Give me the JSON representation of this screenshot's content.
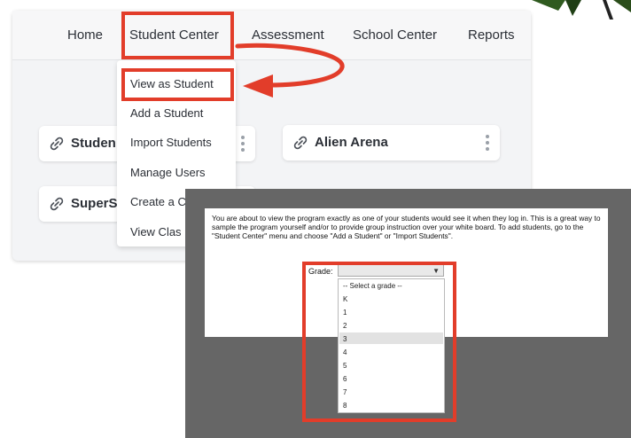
{
  "nav": {
    "home": "Home",
    "student_center": "Student Center",
    "assessment": "Assessment",
    "school_center": "School Center",
    "reports": "Reports"
  },
  "cards": [
    {
      "label": "Studen",
      "icon": "link-icon"
    },
    {
      "label": "Alien Arena",
      "icon": "link-icon"
    },
    {
      "label": "SuperS",
      "icon": "link-icon"
    }
  ],
  "menu": {
    "items": [
      "View as Student",
      "Add a Student",
      "Import Students",
      "Manage Users",
      "Create a C",
      "View Clas"
    ]
  },
  "modal": {
    "message": "You are about to view the program exactly as one of your students would see it when they log in. This is a great way to sample the program yourself and/or to provide group instruction over your white board. To add students, go to the \"Student Center\" menu and choose \"Add a Student\" or \"Import Students\".",
    "grade_label": "Grade:",
    "grade_value": "",
    "grade_options": [
      "-- Select a grade --",
      "K",
      "1",
      "2",
      "3",
      "4",
      "5",
      "6",
      "7",
      "8"
    ],
    "highlighted_option": "3"
  },
  "colors": {
    "highlight": "#e23d2a",
    "modal_backdrop": "#666666"
  }
}
